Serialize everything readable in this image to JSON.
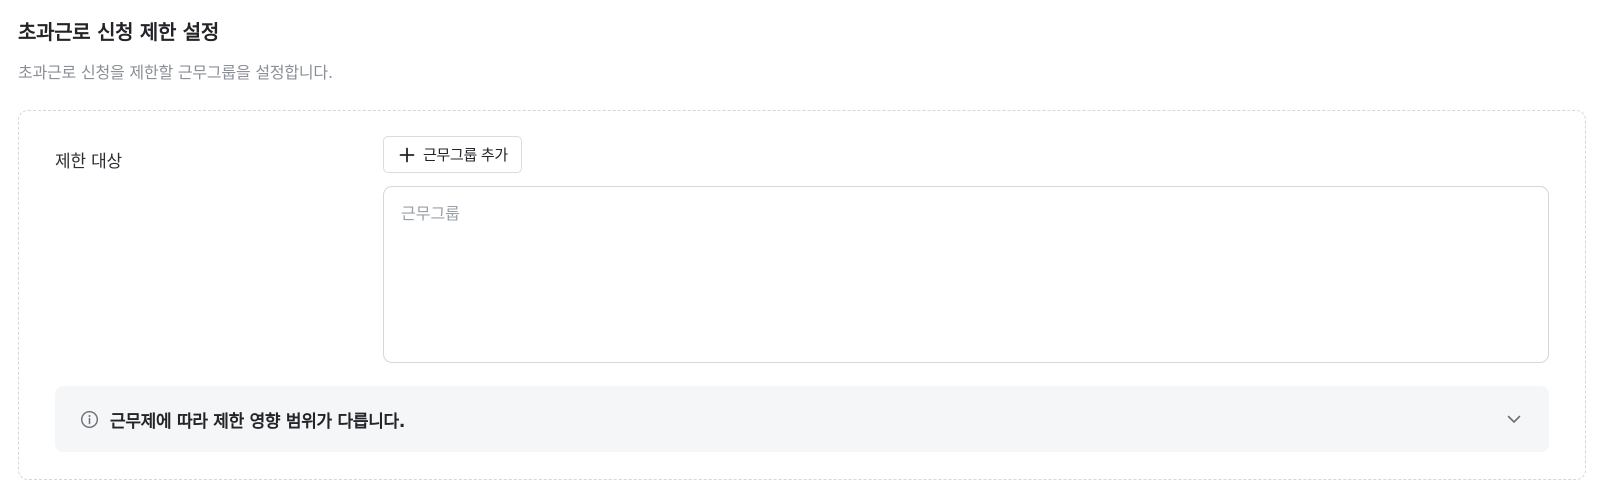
{
  "section": {
    "title": "초과근로 신청 제한 설정",
    "subtitle": "초과근로 신청을 제한할 근무그룹을 설정합니다."
  },
  "restriction": {
    "label": "제한 대상",
    "add_button_label": "근무그룹 추가",
    "add_button_icon": "plus-icon",
    "group_field": {
      "placeholder": "근무그룹",
      "value": ""
    }
  },
  "notice": {
    "icon": "info-icon",
    "text": "근무제에 따라 제한 영향 범위가 다릅니다.",
    "toggle_icon": "chevron-down-icon",
    "expanded": false
  },
  "colors": {
    "text_primary": "#222428",
    "text_secondary": "#8b8f96",
    "border": "#d4d7dc",
    "notice_bg": "#f5f6f8"
  }
}
